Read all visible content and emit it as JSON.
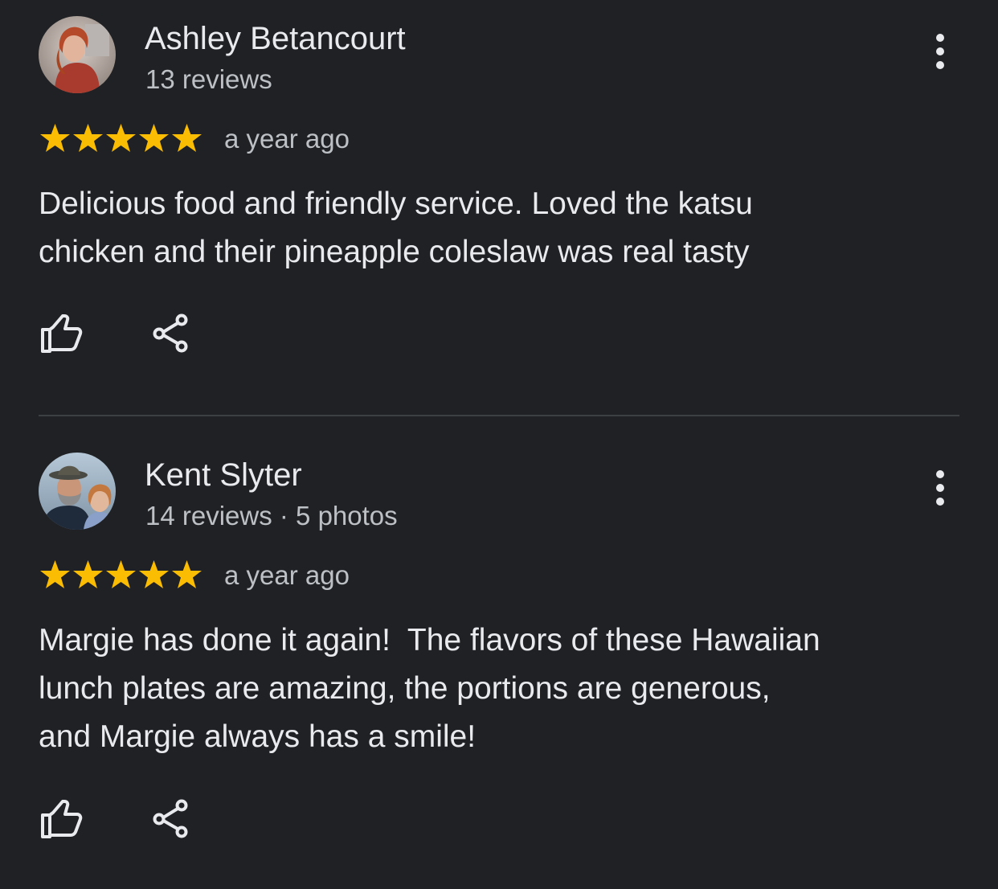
{
  "colors": {
    "background": "#202124",
    "text_primary": "#e8eaed",
    "text_secondary": "#bdc1c6",
    "star": "#fbbc04",
    "divider": "#3c4043"
  },
  "reviews": [
    {
      "author": "Ashley Betancourt",
      "meta": "13 reviews",
      "rating": 5,
      "date": "a year ago",
      "lines": [
        "Delicious food and friendly service. Loved the katsu",
        "chicken and their pineapple coleslaw was real tasty"
      ],
      "icons": {
        "avatar": "profile-photo",
        "more": "more-vert-icon",
        "like": "thumb-up-icon",
        "share": "share-icon"
      }
    },
    {
      "author": "Kent Slyter",
      "meta": "14 reviews · 5 photos",
      "rating": 5,
      "date": "a year ago",
      "lines": [
        "Margie has done it again!  The flavors of these Hawaiian",
        "lunch plates are amazing, the portions are generous,",
        "and Margie always has a smile!"
      ],
      "icons": {
        "avatar": "profile-photo",
        "more": "more-vert-icon",
        "like": "thumb-up-icon",
        "share": "share-icon"
      }
    }
  ]
}
